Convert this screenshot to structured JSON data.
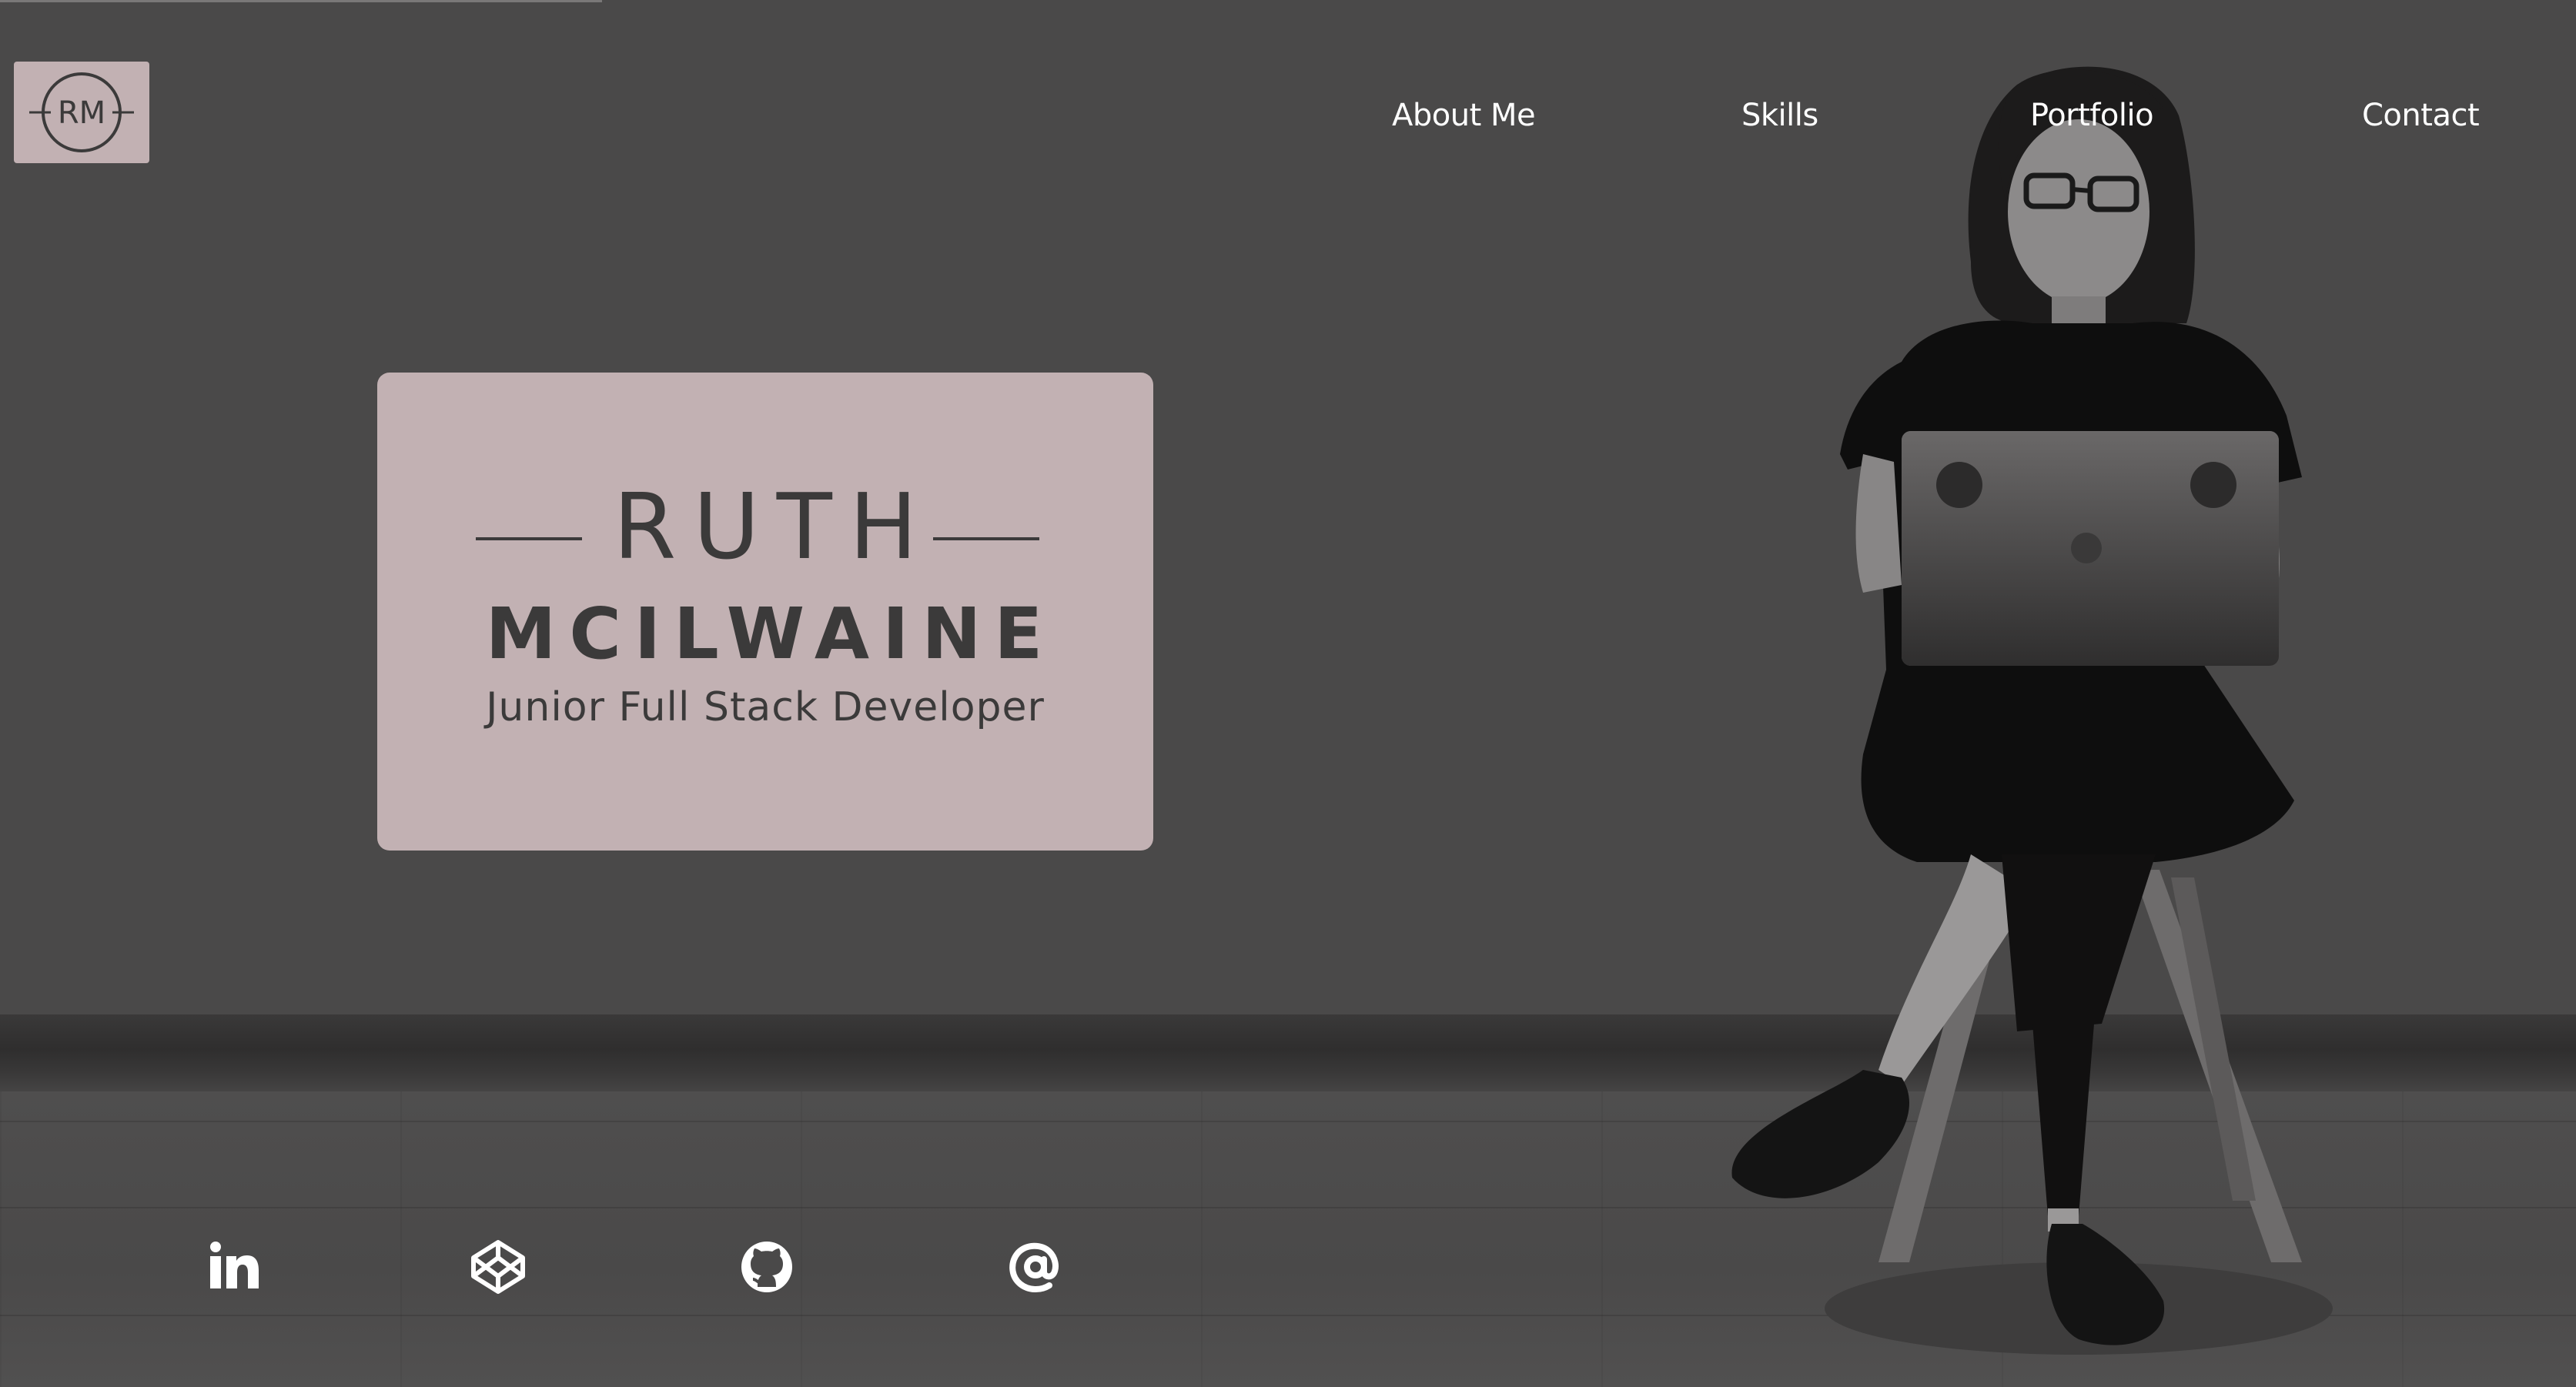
{
  "logo": {
    "initials": "RM",
    "icon": "rm-monogram-logo"
  },
  "nav": {
    "items": [
      {
        "label": "About Me"
      },
      {
        "label": "Skills"
      },
      {
        "label": "Portfolio"
      },
      {
        "label": "Contact"
      }
    ]
  },
  "hero": {
    "first_name": "RUTH",
    "last_name": "MCILWAINE",
    "role": "Junior Full Stack Developer"
  },
  "social": {
    "items": [
      {
        "icon": "linkedin-icon"
      },
      {
        "icon": "codepen-icon"
      },
      {
        "icon": "github-icon"
      },
      {
        "icon": "email-at-icon"
      }
    ]
  },
  "colors": {
    "background": "#4a4949",
    "card": "#c2b1b3",
    "card_text": "#3b3a3a",
    "nav_text": "#ffffff"
  }
}
